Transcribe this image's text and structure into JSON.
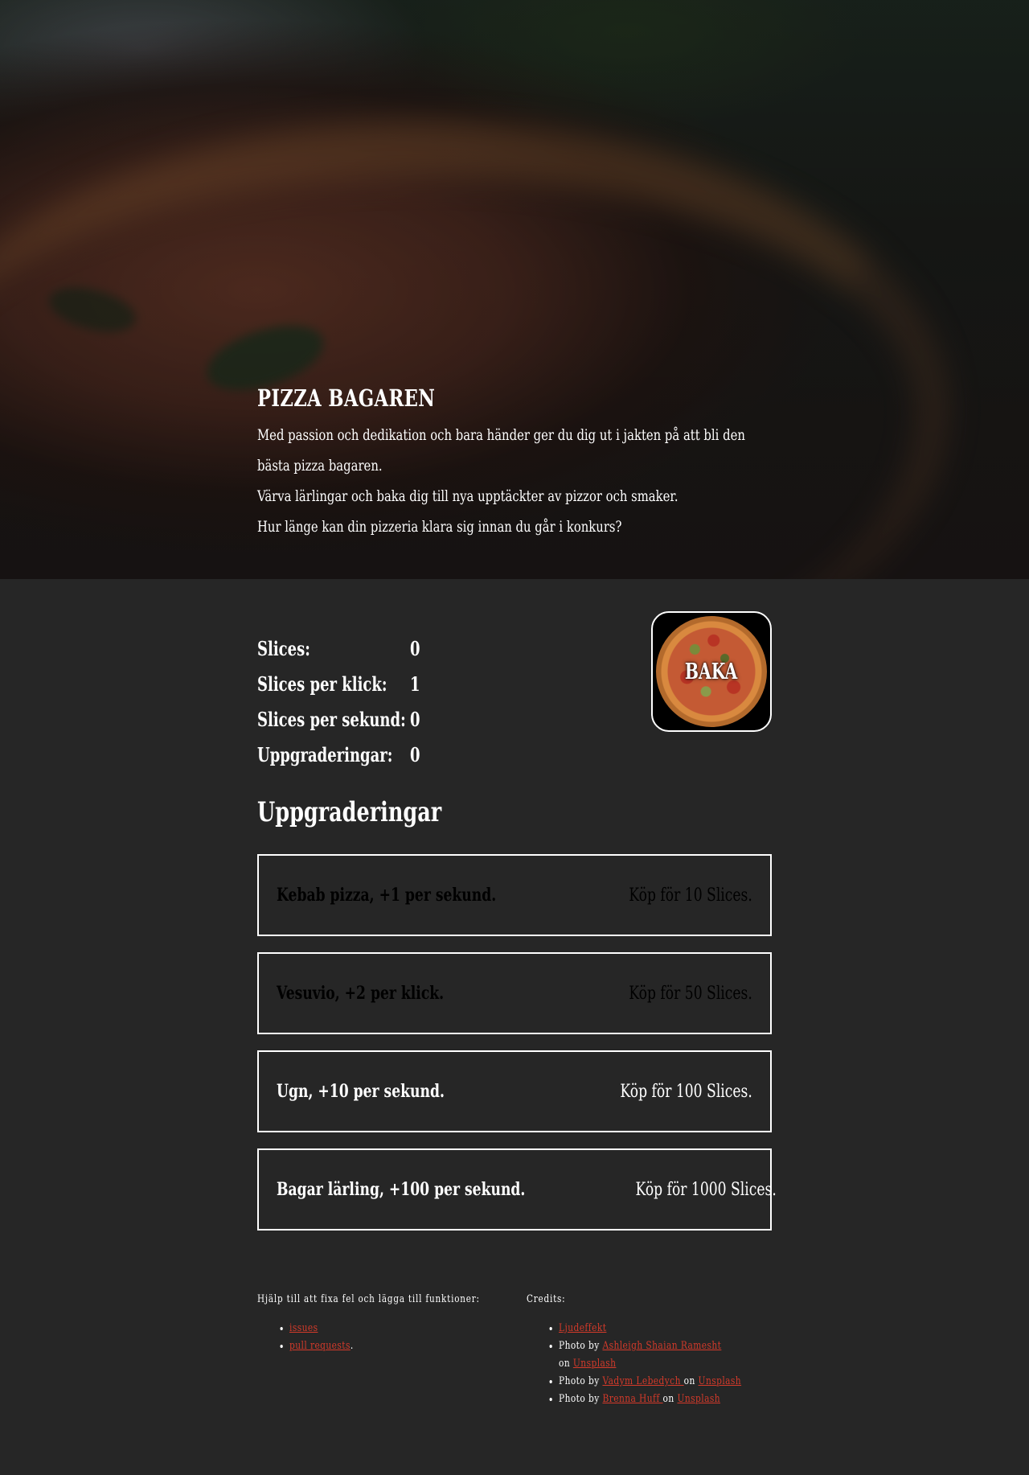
{
  "hero": {
    "title": "PIZZA BAGAREN",
    "lines": [
      "Med passion och dedikation och bara händer ger du dig ut i jakten på att bli den bästa pizza bagaren.",
      "Värva lärlingar och baka dig till nya upptäckter av pizzor och smaker.",
      "Hur länge kan din pizzeria klara sig innan du går i konkurs?"
    ]
  },
  "stats": [
    {
      "label": "Slices:",
      "value": "0"
    },
    {
      "label": "Slices per klick:",
      "value": "1"
    },
    {
      "label": "Slices per sekund:",
      "value": "0"
    },
    {
      "label": "Uppgraderingar:",
      "value": "0"
    }
  ],
  "baka_button": {
    "label": "BAKA",
    "image_alt": "pizza"
  },
  "upgrades": {
    "title": "Uppgraderingar",
    "items": [
      {
        "name": "Kebab pizza, +1 per sekund.",
        "price": "Köp för 10 Slices.",
        "state": "locked"
      },
      {
        "name": "Vesuvio, +2 per klick.",
        "price": "Köp för 50 Slices.",
        "state": "locked"
      },
      {
        "name": "Ugn, +10 per sekund.",
        "price": "Köp för 100 Slices.",
        "state": "available"
      },
      {
        "name": "Bagar lärling, +100 per sekund.",
        "price": "Köp för 1000 Slices.",
        "state": "available"
      }
    ]
  },
  "footer": {
    "help": {
      "heading": "Hjälp till att fixa fel och lägga till funktioner:",
      "links": [
        {
          "text": "issues",
          "suffix": ""
        },
        {
          "text": "pull requests",
          "suffix": "."
        }
      ]
    },
    "credits": {
      "heading": "Credits:",
      "sound": "Ljudeffekt",
      "photos": [
        {
          "prefix": "Photo by ",
          "author": "Ashleigh Shaian Ramesht",
          "on": " on ",
          "site": "Unsplash"
        },
        {
          "prefix": "Photo by ",
          "author": "Vadym Lebedych ",
          "on": " on ",
          "site": "Unsplash"
        },
        {
          "prefix": "Photo by ",
          "author": "Brenna Huff ",
          "on": " on ",
          "site": "Unsplash "
        }
      ]
    }
  },
  "colors": {
    "background": "#262626",
    "text": "#ffffff",
    "link": "#d53a2a",
    "locked_text": "#000000"
  }
}
